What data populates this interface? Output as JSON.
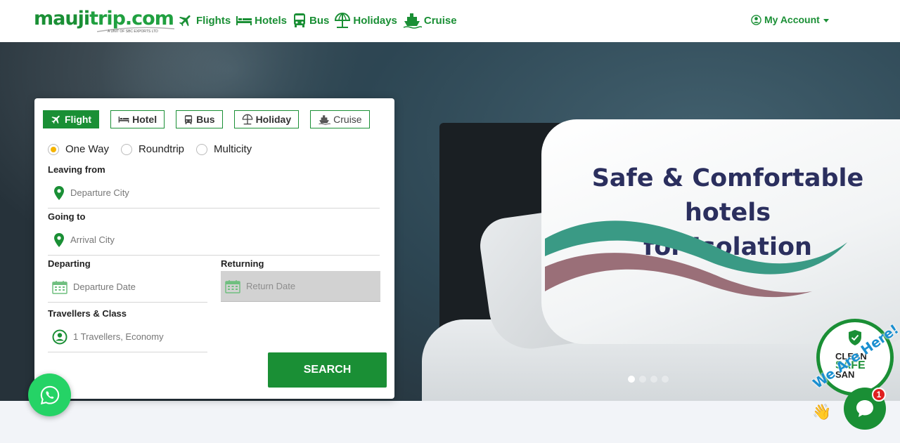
{
  "brand": {
    "name_main": "mauji",
    "name_trip": "trip.com",
    "tagline": "A UNIT OF SBC EXPORTS LTD",
    "color": "#1a8f35"
  },
  "nav": {
    "items": [
      {
        "label": "Flights",
        "icon": "plane-icon"
      },
      {
        "label": "Hotels",
        "icon": "bed-icon"
      },
      {
        "label": "Bus",
        "icon": "bus-icon"
      },
      {
        "label": "Holidays",
        "icon": "umbrella-icon"
      },
      {
        "label": "Cruise",
        "icon": "ship-icon"
      }
    ],
    "account_label": "My Account"
  },
  "hero": {
    "title_line1": "Safe & Comfortable hotels",
    "title_line2": "for Isolation",
    "slides_total": 4,
    "active_slide": 1
  },
  "search": {
    "tabs": [
      {
        "label": "Flight",
        "active": true
      },
      {
        "label": "Hotel",
        "active": false
      },
      {
        "label": "Bus",
        "active": false
      },
      {
        "label": "Holiday",
        "active": false
      },
      {
        "label": "Cruise",
        "active": false
      }
    ],
    "trip_types": [
      "One Way",
      "Roundtrip",
      "Multicity"
    ],
    "selected_trip_type": "One Way",
    "leaving_label": "Leaving from",
    "leaving_placeholder": "Departure City",
    "going_label": "Going to",
    "going_placeholder": "Arrival City",
    "departing_label": "Departing",
    "departing_placeholder": "Departure Date",
    "returning_label": "Returning",
    "returning_placeholder": "Return Date",
    "travellers_label": "Travellers & Class",
    "travellers_value": "1 Travellers, Economy",
    "search_button": "SEARCH"
  },
  "widgets": {
    "clean_line1": "CLEAN",
    "clean_line2": "SAFE",
    "clean_line3": "SAN",
    "here_text": "We Are Here!",
    "chat_unread": "1"
  }
}
